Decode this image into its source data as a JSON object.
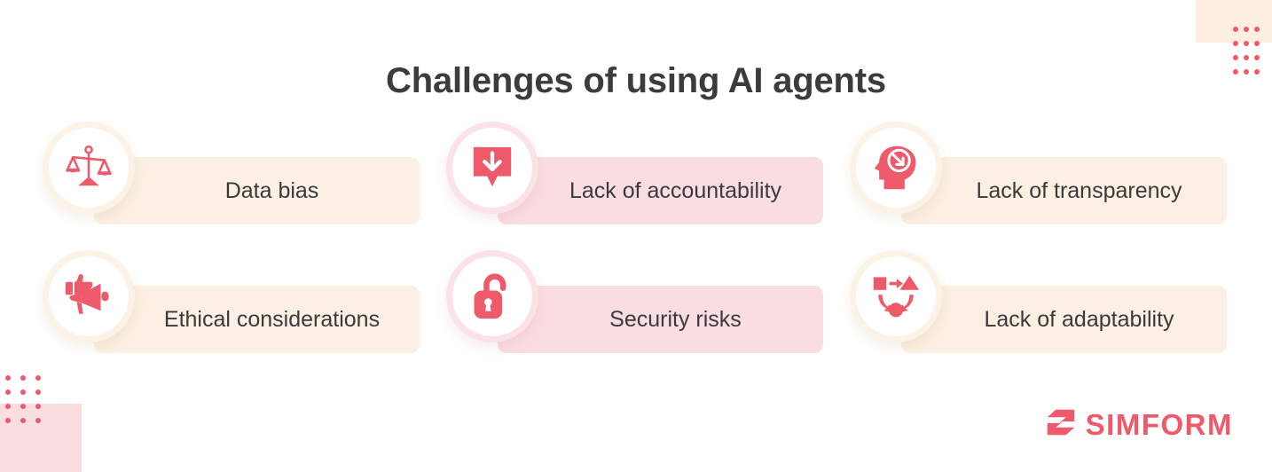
{
  "header": {
    "title": "Challenges of using AI agents"
  },
  "theme": {
    "accent": "#EE5A6A",
    "cream_pill": "#FBF0E3",
    "pink_pill": "#FADDE1",
    "title_color": "#3C3C3C",
    "label_color": "#3A3A3A"
  },
  "items": [
    {
      "label": "Data bias",
      "icon": "balance-scales-icon",
      "tone": "cream"
    },
    {
      "label": "Lack of accountability",
      "icon": "download-pin-icon",
      "tone": "pink"
    },
    {
      "label": "Lack of transparency",
      "icon": "head-arrow-icon",
      "tone": "cream"
    },
    {
      "label": "Ethical considerations",
      "icon": "thumbs-up-megaphone-icon",
      "tone": "cream"
    },
    {
      "label": "Security risks",
      "icon": "open-padlock-icon",
      "tone": "pink"
    },
    {
      "label": "Lack of adaptability",
      "icon": "shapes-cycle-icon",
      "tone": "cream"
    }
  ],
  "footer": {
    "brand": "SIMFORM"
  },
  "decor": {
    "top_right_block": "cream-square",
    "top_right_dots": "dot-grid",
    "bottom_left_block": "pink-square",
    "bottom_left_dots": "dot-grid"
  }
}
